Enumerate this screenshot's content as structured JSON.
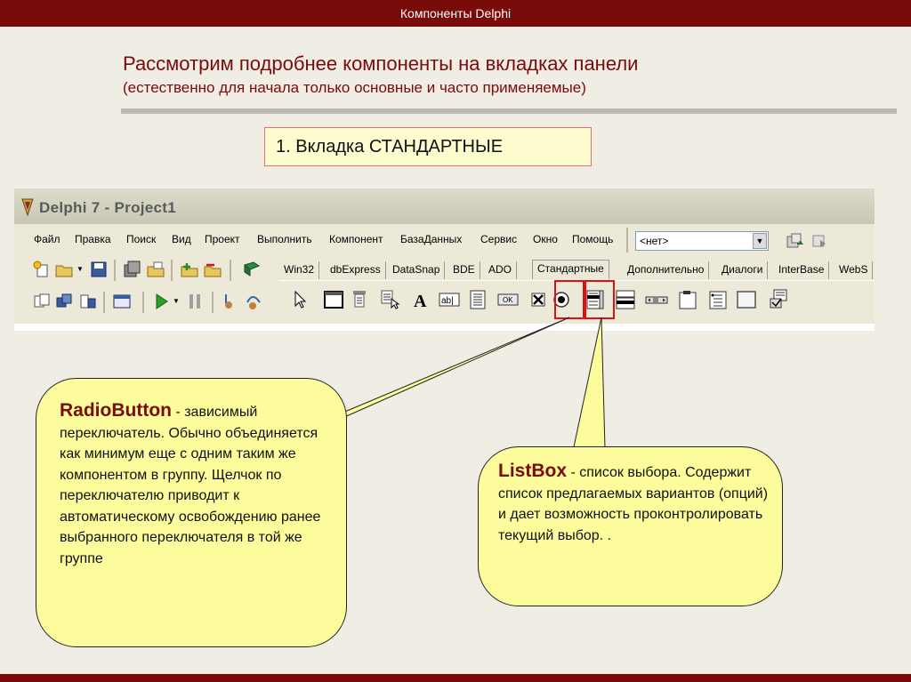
{
  "header": {
    "title": "Компоненты Delphi"
  },
  "slide": {
    "heading": "Рассмотрим подробнее компоненты на вкладках панели",
    "subheading": "(естественно для начала только основные и часто применяемые)",
    "tab_box": "1. Вкладка СТАНДАРТНЫЕ"
  },
  "delphi": {
    "title": "Delphi 7 - Project1",
    "menu": [
      "Файл",
      "Правка",
      "Поиск",
      "Вид",
      "Проект",
      "Выполнить",
      "Компонент",
      "БазаДанных",
      "Сервис",
      "Окно",
      "Помощь"
    ],
    "combo_value": "<нет>",
    "tabs": [
      "Win32",
      "dbExpress",
      "DataSnap",
      "BDE",
      "ADO",
      "Стандартные",
      "Дополнительно",
      "Диалоги",
      "InterBase",
      "WebS"
    ],
    "active_tab": "Стандартные",
    "palette_icons": [
      "pointer-icon",
      "frames-icon",
      "mainmenu-icon",
      "popupmenu-icon",
      "label-icon",
      "edit-icon",
      "memo-icon",
      "button-icon",
      "checkbox-icon",
      "radiobutton-icon",
      "listbox-icon",
      "combobox-icon",
      "scrollbar-icon",
      "groupbox-icon",
      "radiogroup-icon",
      "panel-icon",
      "actionlist-icon"
    ]
  },
  "callouts": {
    "radiobutton": {
      "term": "RadioButton",
      "text": " - зависимый переключатель. Обычно объединяется как минимум еще с одним таким же компонентом в группу. Щелчок по переключателю приводит к автоматическому освобождению ранее выбранного переключателя в той же группе"
    },
    "listbox": {
      "term": "ListBox",
      "text": " - список выбора. Содержит список предлагаемых вариантов (опций) и дает возможность проконтролировать текущий выбор. ."
    }
  },
  "colors": {
    "accent": "#7a0b0b",
    "callout": "#fcfc9c",
    "highlight": "#e01010"
  }
}
